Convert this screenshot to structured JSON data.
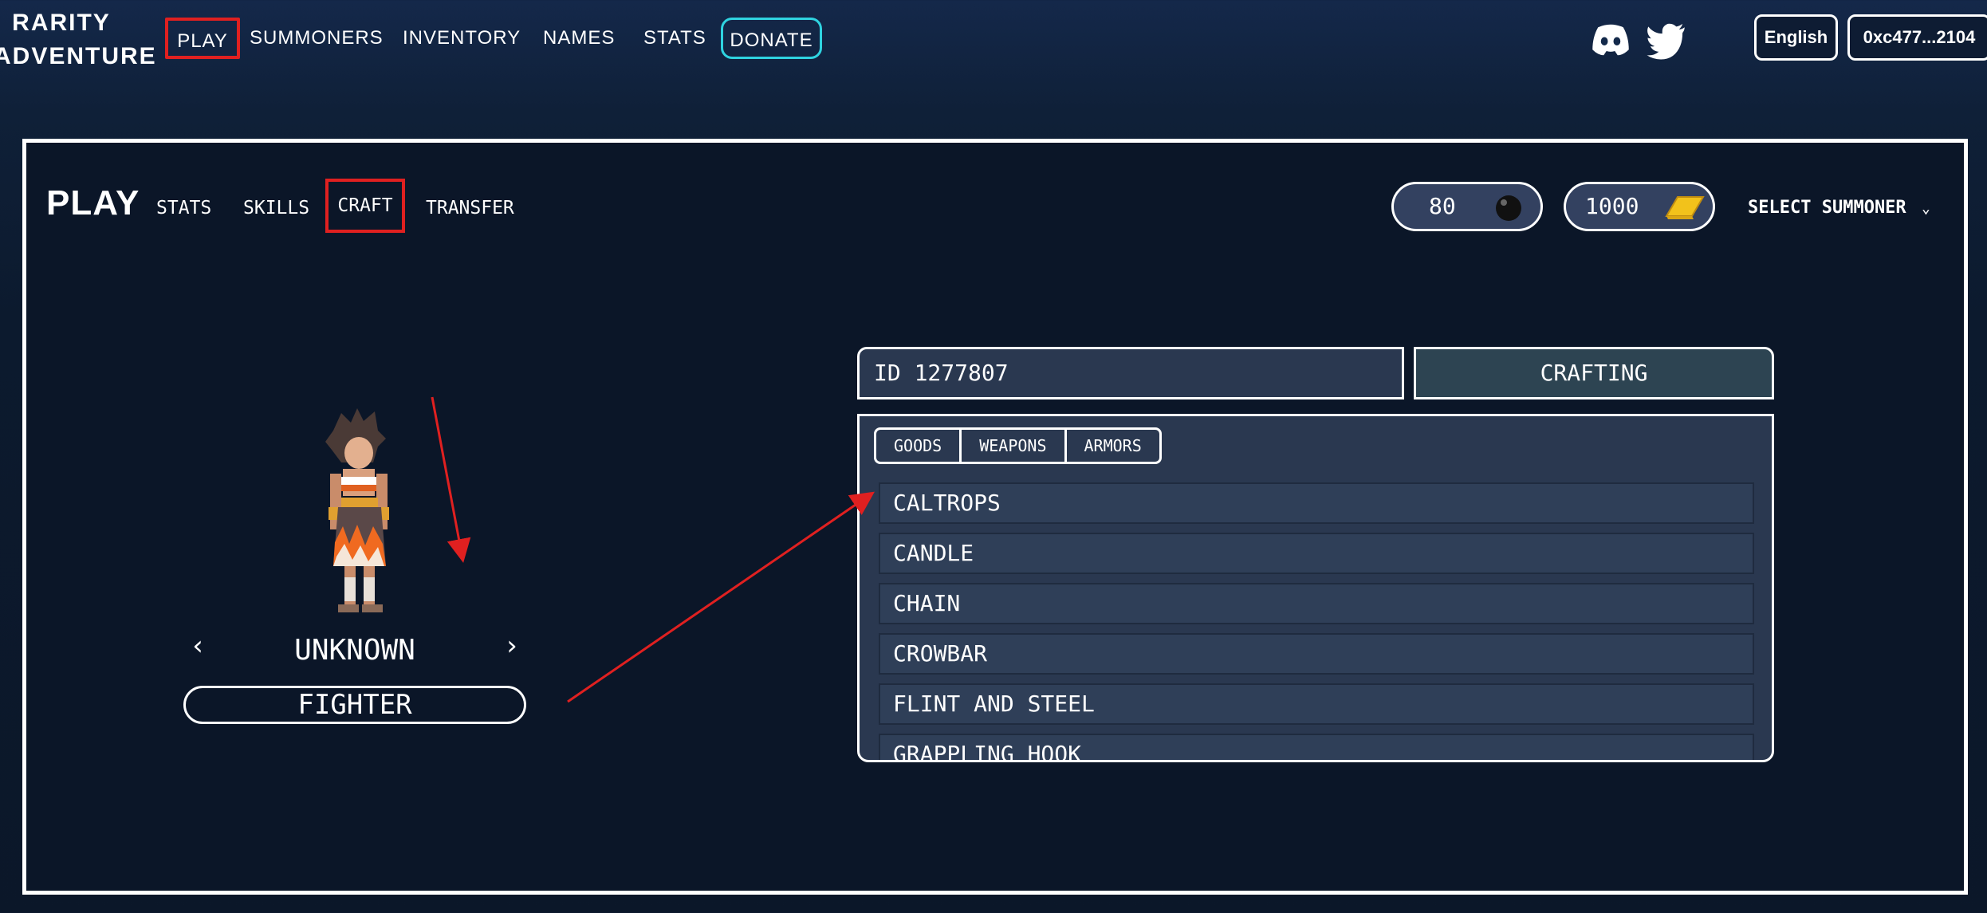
{
  "header": {
    "logo_line1": "RARITY",
    "logo_line2": "ADVENTURE",
    "nav": [
      "PLAY",
      "SUMMONERS",
      "INVENTORY",
      "NAMES",
      "STATS",
      "DONATE"
    ],
    "language": "English",
    "wallet": "0xc477...2104",
    "social_icons": [
      "discord-icon",
      "twitter-icon"
    ]
  },
  "play": {
    "title": "PLAY",
    "subnav": [
      "STATS",
      "SKILLS",
      "CRAFT",
      "TRANSFER"
    ],
    "craft_materials": "80",
    "gold": "1000",
    "select_summoner": "SELECT SUMMONER"
  },
  "character": {
    "name": "UNKNOWN",
    "class": "FIGHTER"
  },
  "crafting": {
    "id_label": "ID 1277807",
    "button": "CRAFTING",
    "tabs": [
      "GOODS",
      "WEAPONS",
      "ARMORS"
    ],
    "items": [
      "CALTROPS",
      "CANDLE",
      "CHAIN",
      "CROWBAR",
      "FLINT AND STEEL",
      "GRAPPLING HOOK"
    ]
  },
  "colors": {
    "highlight": "#e02020",
    "donate_border": "#2fd3e0",
    "panel_bg": "#2a3850"
  }
}
